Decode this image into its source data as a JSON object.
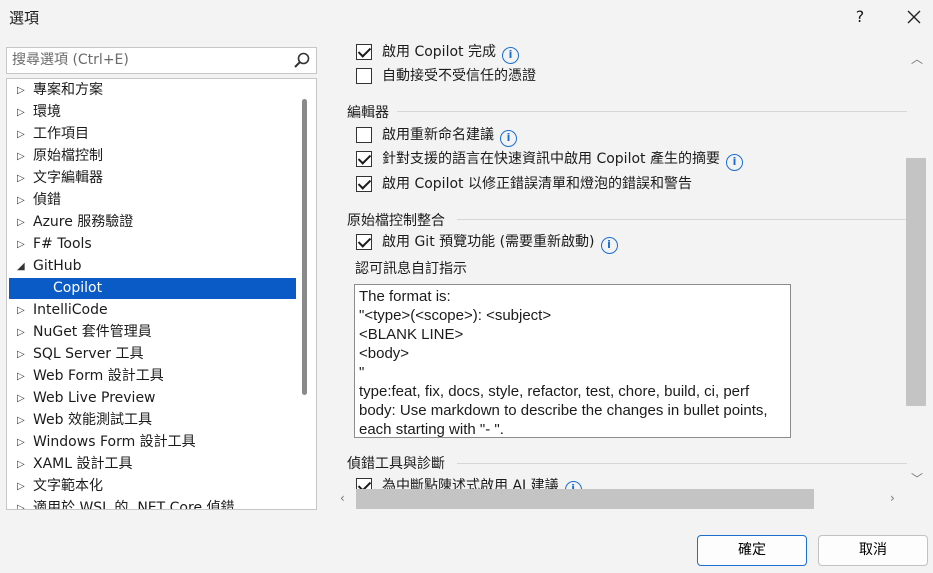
{
  "window": {
    "title": "選項",
    "help": "?"
  },
  "search": {
    "placeholder": "搜尋選項 (Ctrl+E)"
  },
  "tree": {
    "items": [
      {
        "label": "專案和方案"
      },
      {
        "label": "環境"
      },
      {
        "label": "工作項目"
      },
      {
        "label": "原始檔控制"
      },
      {
        "label": "文字編輯器"
      },
      {
        "label": "偵錯"
      },
      {
        "label": "Azure 服務驗證"
      },
      {
        "label": "F# Tools"
      },
      {
        "label": "GitHub"
      },
      {
        "label": "Copilot"
      },
      {
        "label": "IntelliCode"
      },
      {
        "label": "NuGet 套件管理員"
      },
      {
        "label": "SQL Server 工具"
      },
      {
        "label": "Web Form 設計工具"
      },
      {
        "label": "Web Live Preview"
      },
      {
        "label": "Web 效能測試工具"
      },
      {
        "label": "Windows Form 設計工具"
      },
      {
        "label": "XAML 設計工具"
      },
      {
        "label": "文字範本化"
      },
      {
        "label": "適用於 WSL 的 .NET Core 偵錯"
      }
    ]
  },
  "settings": {
    "top": {
      "enable_completions": "啟用 Copilot 完成",
      "auto_accept_certs": "自動接受不受信任的憑證"
    },
    "editor": {
      "title": "編輯器",
      "rename_suggestions": "啟用重新命名建議",
      "quick_info_summary": "針對支援的語言在快速資訊中啟用 Copilot 產生的摘要",
      "fix_errors": "啟用 Copilot 以修正錯誤清單和燈泡的錯誤和警告"
    },
    "source_control": {
      "title": "原始檔控制整合",
      "git_preview": "啟用 Git 預覽功能 (需要重新啟動)",
      "commit_instructions_label": "認可訊息自訂指示",
      "commit_instructions_value": "The format is:\n\"<type>(<scope>): <subject>\n<BLANK LINE>\n<body>\n\"\ntype:feat, fix, docs, style, refactor, test, chore, build, ci, perf\nbody: Use markdown to describe the changes in bullet points, each starting with \"- \"."
    },
    "debugger": {
      "title": "偵錯工具與診斷",
      "ai_suggestions": "為中斷點陳述式啟用 AI 建議"
    }
  },
  "buttons": {
    "ok": "確定",
    "cancel": "取消"
  }
}
